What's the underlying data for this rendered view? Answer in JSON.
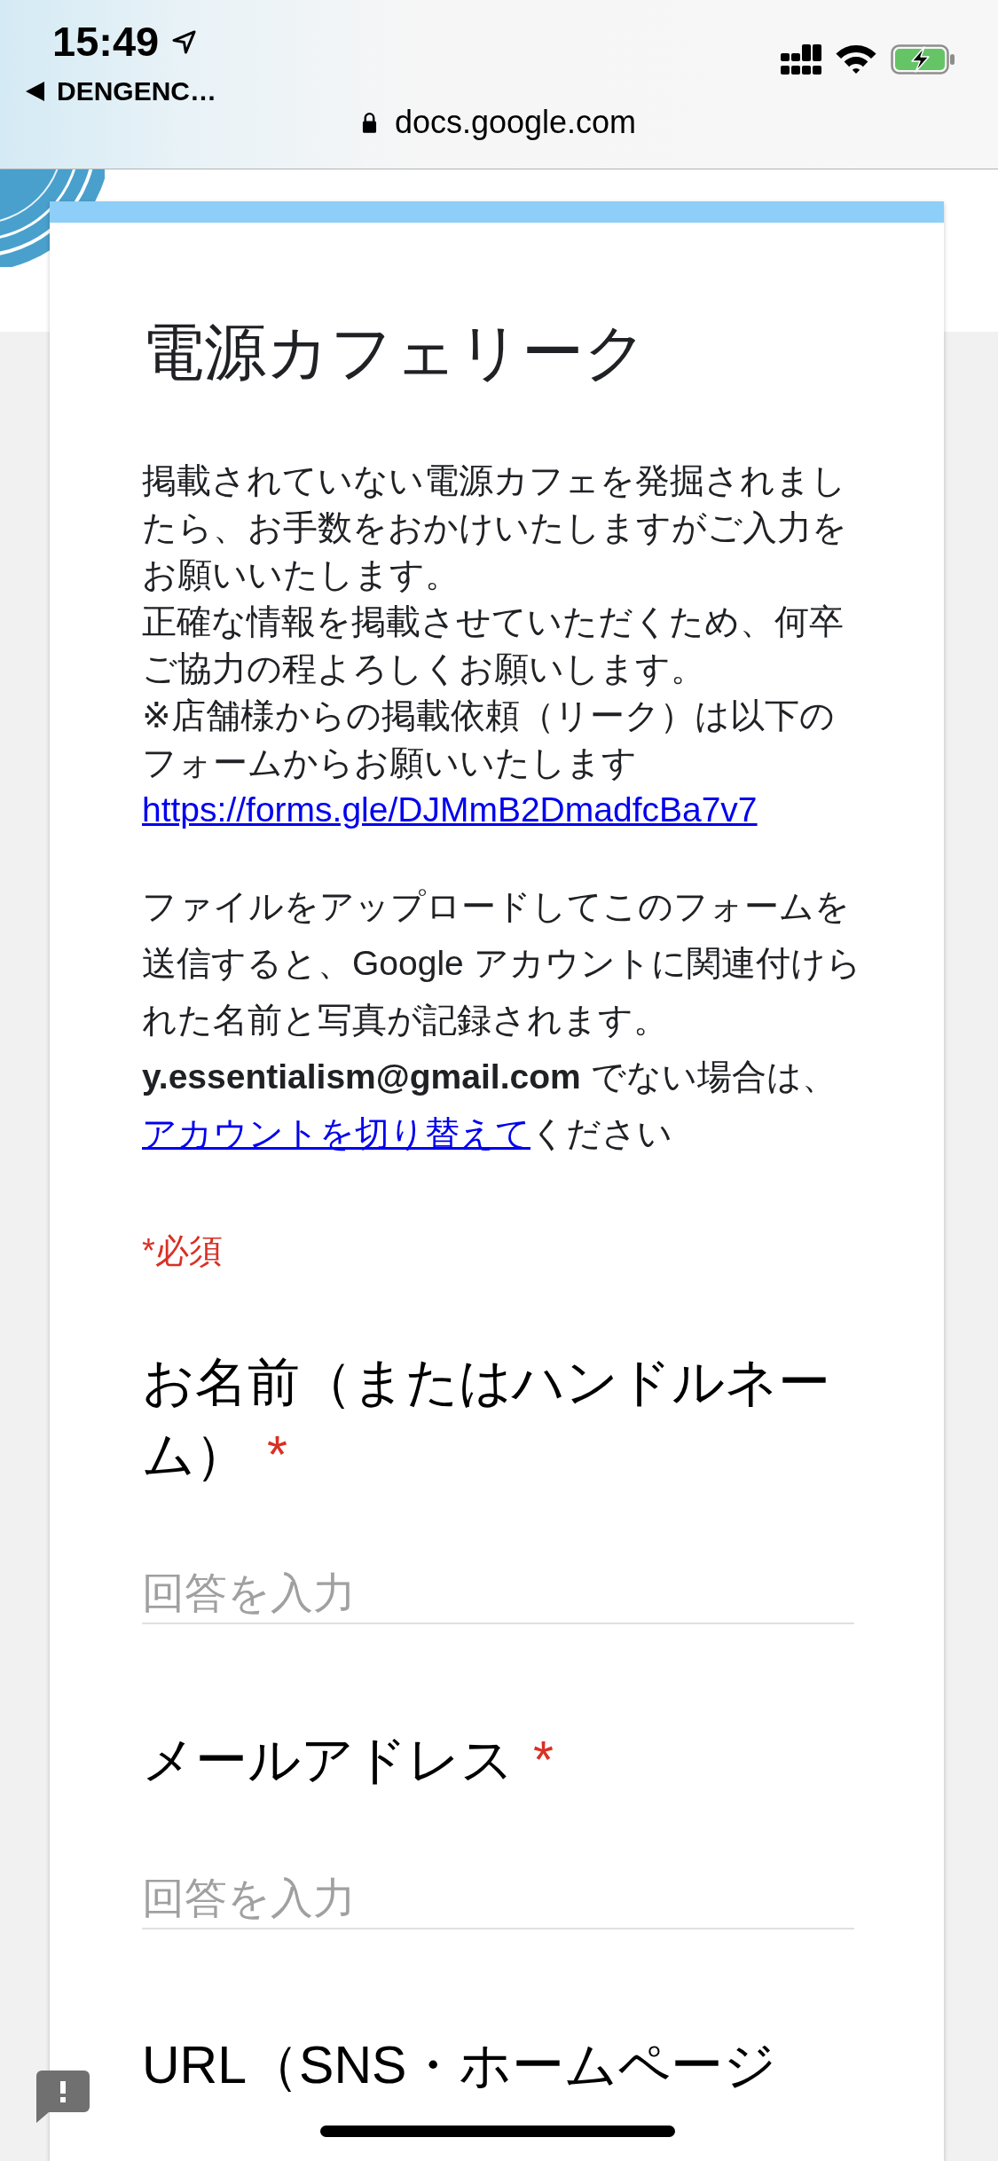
{
  "status_bar": {
    "time": "15:49",
    "back_label": "DENGENC…"
  },
  "address_bar": {
    "url": "docs.google.com"
  },
  "form": {
    "title": "電源カフェリーク",
    "description": [
      "掲載されていない電源カフェを発掘されましたら、お手数をおかけいたしますがご入力をお願いいたします。",
      "正確な情報を掲載させていただくため、何卒ご協力の程よろしくお願いします。",
      "※店舗様からの掲載依頼（リーク）は以下のフォームからお願いいたします"
    ],
    "description_link": "https://forms.gle/DJMmB2DmadfcBa7v7",
    "account_notice": {
      "text": "ファイルをアップロードしてこのフォームを送信すると、Google アカウントに関連付けられた名前と写真が記録されます。**y.essentialism@gmail.com** でない場合は、",
      "link": "アカウントを切り替えて",
      "text_after": "ください"
    },
    "required_note": "*必須",
    "questions": [
      {
        "title": "お名前（またはハンドルネーム）",
        "required_mark": "*",
        "placeholder": "回答を入力"
      },
      {
        "title": "メールアドレス",
        "required_mark": "*",
        "placeholder": "回答を入力"
      },
      {
        "title": "URL（SNS・ホームページ"
      }
    ]
  }
}
